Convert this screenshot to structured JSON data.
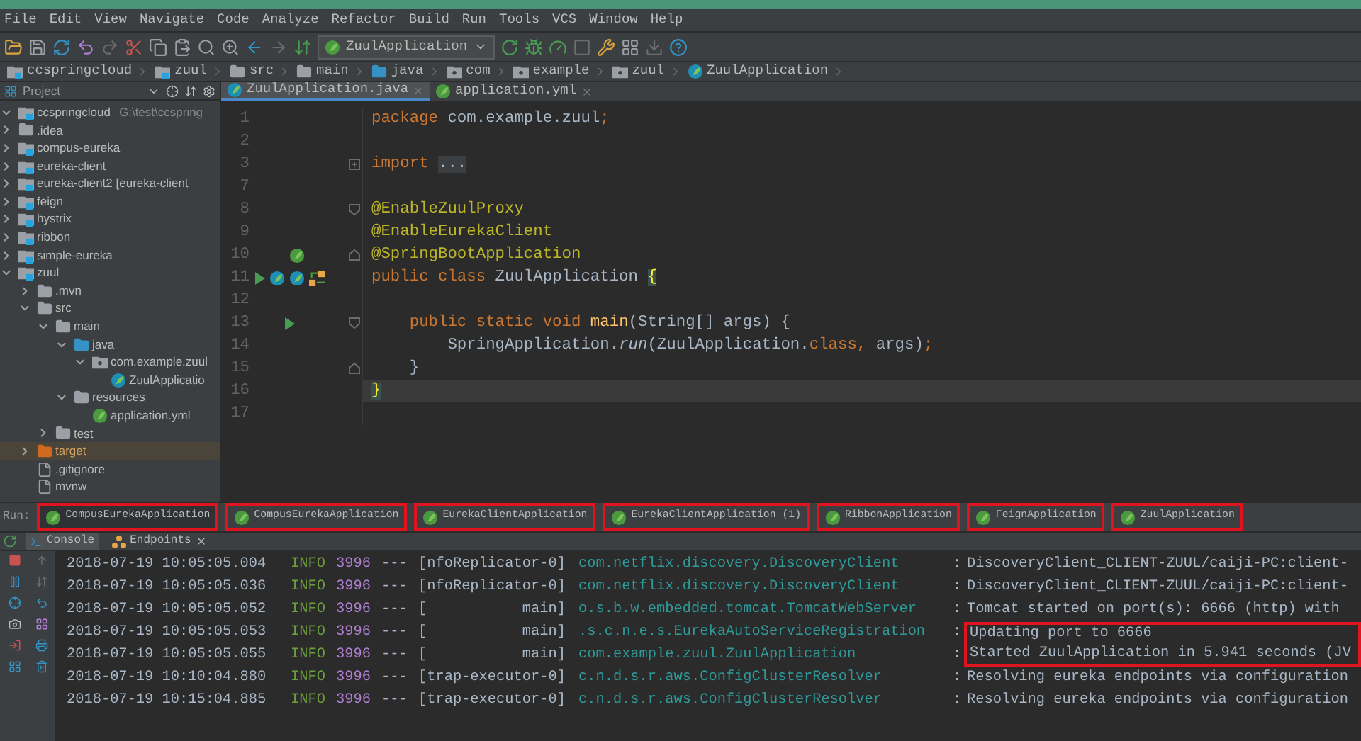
{
  "menu": [
    "File",
    "Edit",
    "View",
    "Navigate",
    "Code",
    "Analyze",
    "Refactor",
    "Build",
    "Run",
    "Tools",
    "VCS",
    "Window",
    "Help"
  ],
  "toolbar": {
    "run_config": "ZuulApplication"
  },
  "breadcrumbs": [
    {
      "label": "ccspringcloud",
      "kind": "module"
    },
    {
      "label": "zuul",
      "kind": "module"
    },
    {
      "label": "src",
      "kind": "folder"
    },
    {
      "label": "main",
      "kind": "folder"
    },
    {
      "label": "java",
      "kind": "source"
    },
    {
      "label": "com",
      "kind": "package"
    },
    {
      "label": "example",
      "kind": "package"
    },
    {
      "label": "zuul",
      "kind": "package"
    },
    {
      "label": "ZuulApplication",
      "kind": "class"
    }
  ],
  "project_panel": {
    "title": "Project"
  },
  "editor_tabs": [
    {
      "label": "ZuulApplication.java",
      "kind": "class",
      "selected": true
    },
    {
      "label": "application.yml",
      "kind": "yml",
      "selected": false
    }
  ],
  "tree": [
    {
      "label": "ccspringcloud",
      "path": "G:\\test\\ccspring",
      "kind": "module",
      "expanded": true,
      "children": [
        {
          "label": ".idea",
          "kind": "folder",
          "expanded": false
        },
        {
          "label": "compus-eureka",
          "kind": "module",
          "expanded": false
        },
        {
          "label": "eureka-client",
          "kind": "module",
          "expanded": false
        },
        {
          "label": "eureka-client2 [eureka-client",
          "kind": "module",
          "expanded": false
        },
        {
          "label": "feign",
          "kind": "module",
          "expanded": false
        },
        {
          "label": "hystrix",
          "kind": "module",
          "expanded": false
        },
        {
          "label": "ribbon",
          "kind": "module",
          "expanded": false
        },
        {
          "label": "simple-eureka",
          "kind": "module",
          "expanded": false
        },
        {
          "label": "zuul",
          "kind": "module",
          "expanded": true,
          "children": [
            {
              "label": ".mvn",
              "kind": "folder",
              "expanded": false
            },
            {
              "label": "src",
              "kind": "folder",
              "expanded": true,
              "children": [
                {
                  "label": "main",
                  "kind": "folder",
                  "expanded": true,
                  "children": [
                    {
                      "label": "java",
                      "kind": "source",
                      "expanded": true,
                      "children": [
                        {
                          "label": "com.example.zuul",
                          "kind": "package",
                          "expanded": true,
                          "children": [
                            {
                              "label": "ZuulApplicatio",
                              "kind": "class"
                            }
                          ]
                        }
                      ]
                    },
                    {
                      "label": "resources",
                      "kind": "resources",
                      "expanded": true,
                      "children": [
                        {
                          "label": "application.yml",
                          "kind": "yml"
                        }
                      ]
                    }
                  ]
                },
                {
                  "label": "test",
                  "kind": "folder",
                  "expanded": false
                }
              ]
            },
            {
              "label": "target",
              "kind": "excluded",
              "expanded": false
            },
            {
              "label": ".gitignore",
              "kind": "file"
            },
            {
              "label": "mvnw",
              "kind": "file"
            }
          ]
        }
      ]
    }
  ],
  "code": [
    {
      "number": "1",
      "current": false,
      "tokens": [
        {
          "kind": "keyword",
          "text": "package "
        },
        {
          "kind": "plain",
          "text": "com.example.zuul"
        },
        {
          "kind": "keyword",
          "text": ";"
        }
      ]
    },
    {
      "number": "2",
      "current": false
    },
    {
      "number": "3",
      "current": false,
      "fold": {
        "kind": "plus"
      },
      "tokens": [
        {
          "kind": "keyword",
          "text": "import "
        },
        {
          "kind": "folded",
          "text": "..."
        }
      ]
    },
    {
      "number": "7",
      "current": false
    },
    {
      "number": "8",
      "current": false,
      "fold": {
        "kind": "open"
      },
      "tokens": [
        {
          "kind": "annotation",
          "text": "@EnableZuulProxy"
        }
      ]
    },
    {
      "number": "9",
      "current": false,
      "tokens": [
        {
          "kind": "annotation",
          "text": "@EnableEurekaClient"
        }
      ]
    },
    {
      "number": "10",
      "current": false,
      "fold": {
        "kind": "close"
      },
      "gutter": {
        "kind": "bean"
      },
      "tokens": [
        {
          "kind": "annotation",
          "text": "@SpringBootApplication"
        }
      ]
    },
    {
      "number": "11",
      "current": false,
      "gutter": {
        "kind": "class"
      },
      "tokens": [
        {
          "kind": "keyword",
          "text": "public class "
        },
        {
          "kind": "plain",
          "text": "ZuulApplication "
        },
        {
          "kind": "brace",
          "text": "{"
        }
      ]
    },
    {
      "number": "12",
      "current": false
    },
    {
      "number": "13",
      "current": false,
      "fold": {
        "kind": "open"
      },
      "gutter": {
        "kind": "run"
      },
      "tokens": [
        {
          "kind": "keyword",
          "text": "    public static void "
        },
        {
          "kind": "method",
          "text": "main"
        },
        {
          "kind": "plain",
          "text": "(String[] args) {"
        }
      ]
    },
    {
      "number": "14",
      "current": false,
      "tokens": [
        {
          "kind": "plain",
          "text": "        SpringApplication."
        },
        {
          "kind": "static",
          "text": "run"
        },
        {
          "kind": "plain",
          "text": "(ZuulApplication."
        },
        {
          "kind": "keyword",
          "text": "class, "
        },
        {
          "kind": "plain",
          "text": "args)"
        },
        {
          "kind": "keyword",
          "text": ";"
        }
      ]
    },
    {
      "number": "15",
      "current": false,
      "fold": {
        "kind": "close"
      },
      "tokens": [
        {
          "kind": "plain",
          "text": "    }"
        }
      ]
    },
    {
      "number": "16",
      "current": true,
      "tokens": [
        {
          "kind": "brace",
          "text": "}"
        }
      ]
    },
    {
      "number": "17",
      "current": false
    }
  ],
  "run_bar": {
    "label": "Run:",
    "tabs": [
      {
        "label": "CompusEurekaApplication",
        "selected": true,
        "boxed": true
      },
      {
        "label": "CompusEurekaApplication",
        "selected": false,
        "boxed": true
      },
      {
        "label": "EurekaClientApplication",
        "selected": false,
        "boxed": true
      },
      {
        "label": "EurekaClientApplication (1)",
        "selected": false,
        "boxed": true
      },
      {
        "label": "RibbonApplication",
        "selected": false,
        "boxed": true
      },
      {
        "label": "FeignApplication",
        "selected": false,
        "boxed": true
      },
      {
        "label": "ZuulApplication",
        "selected": false,
        "boxed": true
      }
    ]
  },
  "console_tabs": [
    {
      "label": "Console",
      "kind": "console",
      "selected": true
    },
    {
      "label": "Endpoints",
      "kind": "endpoints",
      "selected": false
    }
  ],
  "log": [
    {
      "time": "2018-07-19 10:05:05.004",
      "level": "INFO",
      "pid": "3996",
      "sep": "---",
      "thread": "[nfoReplicator-0]",
      "logger": "com.netflix.discovery.DiscoveryClient",
      "colon": ":",
      "message": "DiscoveryClient_CLIENT-ZUUL/caiji-PC:client-",
      "boxed": false
    },
    {
      "time": "2018-07-19 10:05:05.036",
      "level": "INFO",
      "pid": "3996",
      "sep": "---",
      "thread": "[nfoReplicator-0]",
      "logger": "com.netflix.discovery.DiscoveryClient",
      "colon": ":",
      "message": "DiscoveryClient_CLIENT-ZUUL/caiji-PC:client-",
      "boxed": false
    },
    {
      "time": "2018-07-19 10:05:05.052",
      "level": "INFO",
      "pid": "3996",
      "sep": "---",
      "thread": "[           main]",
      "logger": "o.s.b.w.embedded.tomcat.TomcatWebServer",
      "colon": ":",
      "message": "Tomcat started on port(s): 6666 (http) with",
      "boxed": false
    },
    {
      "time": "2018-07-19 10:05:05.053",
      "level": "INFO",
      "pid": "3996",
      "sep": "---",
      "thread": "[           main]",
      "logger": ".s.c.n.e.s.EurekaAutoServiceRegistration",
      "colon": ":",
      "message": "Updating port to 6666",
      "boxed": true
    },
    {
      "time": "2018-07-19 10:05:05.055",
      "level": "INFO",
      "pid": "3996",
      "sep": "---",
      "thread": "[           main]",
      "logger": "com.example.zuul.ZuulApplication",
      "colon": ":",
      "message": "Started ZuulApplication in 5.941 seconds (JV",
      "boxed": true
    },
    {
      "time": "2018-07-19 10:10:04.880",
      "level": "INFO",
      "pid": "3996",
      "sep": "---",
      "thread": "[trap-executor-0]",
      "logger": "c.n.d.s.r.aws.ConfigClusterResolver",
      "colon": ":",
      "message": "Resolving eureka endpoints via configuration",
      "boxed": false
    },
    {
      "time": "2018-07-19 10:15:04.885",
      "level": "INFO",
      "pid": "3996",
      "sep": "---",
      "thread": "[trap-executor-0]",
      "logger": "c.n.d.s.r.aws.ConfigClusterResolver",
      "colon": ":",
      "message": "Resolving eureka endpoints via configuration",
      "boxed": false
    }
  ]
}
